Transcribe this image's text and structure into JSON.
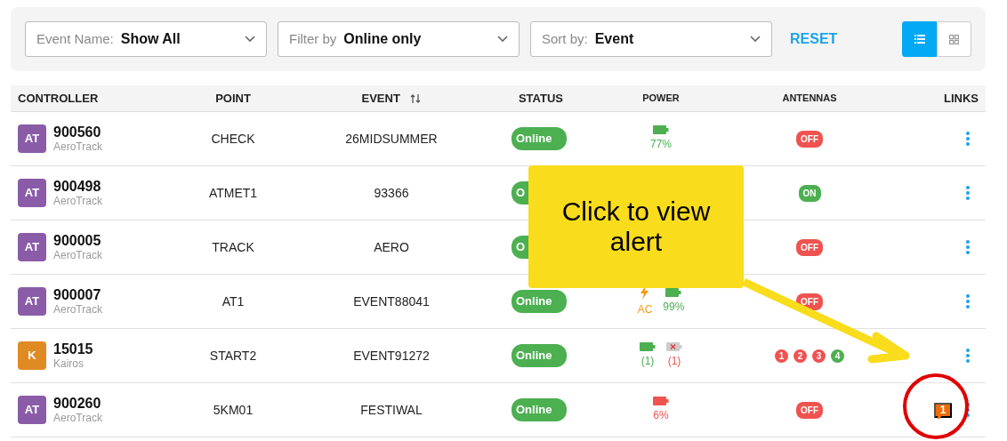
{
  "filters": [
    {
      "label": "Event Name:",
      "value": "Show All"
    },
    {
      "label": "Filter by",
      "value": "Online only"
    },
    {
      "label": "Sort by:",
      "value": "Event"
    }
  ],
  "reset": "RESET",
  "view_toggle": [
    {
      "kind": "list",
      "selected": true
    },
    {
      "kind": "grid",
      "selected": false
    }
  ],
  "table": {
    "columns": [
      {
        "label": "CONTROLLER"
      },
      {
        "label": "POINT"
      },
      {
        "label": "EVENT",
        "sortable": true
      },
      {
        "label": "STATUS"
      },
      {
        "label": "POWER"
      },
      {
        "label": "ANTENNAS"
      },
      {
        "label": "LINKS"
      }
    ],
    "rows": [
      {
        "avatar": "AT",
        "color": "#8a5ca8",
        "id": "900560",
        "type": "AeroTrack",
        "point": "CHECK",
        "event": "26MIDSUMMER",
        "status": "Online",
        "power": [
          {
            "kind": "battery",
            "label": "77%"
          }
        ],
        "antennas": [
          {
            "kind": "summary",
            "label": "OFF",
            "on": false
          }
        ]
      },
      {
        "avatar": "AT",
        "color": "#8a5ca8",
        "id": "900498",
        "type": "AeroTrack",
        "point": "ATMET1",
        "event": "93366",
        "status": "O",
        "antennas": [
          {
            "kind": "summary",
            "label": "ON",
            "on": true
          }
        ]
      },
      {
        "avatar": "AT",
        "color": "#8a5ca8",
        "id": "900005",
        "type": "AeroTrack",
        "point": "TRACK",
        "event": "AERO",
        "status": "O",
        "antennas": [
          {
            "kind": "summary",
            "label": "OFF",
            "on": false
          }
        ]
      },
      {
        "avatar": "AT",
        "color": "#8a5ca8",
        "id": "900007",
        "type": "AeroTrack",
        "point": "AT1",
        "event": "EVENT88041",
        "status": "Online",
        "power": [
          {
            "kind": "ac",
            "label": "AC"
          },
          {
            "kind": "battery",
            "label": "99%"
          }
        ],
        "antennas": [
          {
            "kind": "summary",
            "label": "OFF",
            "on": false
          }
        ]
      },
      {
        "avatar": "K",
        "color": "#e08a24",
        "id": "15015",
        "type": "Kairos",
        "point": "START2",
        "event": "EVENT91272",
        "status": "Online",
        "power": [
          {
            "kind": "battery",
            "label": "(1)"
          },
          {
            "kind": "battery-missing",
            "label": "(1)"
          }
        ],
        "antennas": [
          {
            "kind": "port",
            "label": "1",
            "on": false
          },
          {
            "kind": "port",
            "label": "2",
            "on": false
          },
          {
            "kind": "port",
            "label": "3",
            "on": false
          },
          {
            "kind": "port",
            "label": "4",
            "on": true
          }
        ]
      },
      {
        "avatar": "AT",
        "color": "#8a5ca8",
        "id": "900260",
        "type": "AeroTrack",
        "point": "5KM01",
        "event": "FESTIWAL",
        "status": "Online",
        "power": [
          {
            "kind": "battery-low",
            "label": "6%"
          }
        ],
        "antennas": [
          {
            "kind": "summary",
            "label": "OFF",
            "on": false
          }
        ],
        "alerts": "1"
      }
    ]
  },
  "callout": {
    "text": "Click to view alert"
  }
}
